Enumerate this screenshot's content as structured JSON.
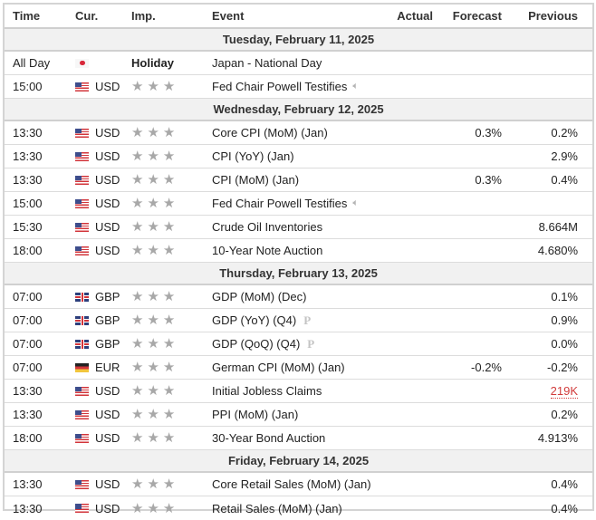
{
  "header": {
    "time": "Time",
    "currency": "Cur.",
    "importance": "Imp.",
    "event": "Event",
    "actual": "Actual",
    "forecast": "Forecast",
    "previous": "Previous"
  },
  "days": [
    {
      "label": "Tuesday, February 11, 2025",
      "rows": [
        {
          "time": "All Day",
          "flag": "jp",
          "currency": "",
          "importance": "Holiday",
          "event": "Japan - National Day",
          "icon": "",
          "actual": "",
          "forecast": "",
          "previous": ""
        },
        {
          "time": "15:00",
          "flag": "us",
          "currency": "USD",
          "importance": 3,
          "event": "Fed Chair Powell Testifies",
          "icon": "sound",
          "actual": "",
          "forecast": "",
          "previous": ""
        }
      ]
    },
    {
      "label": "Wednesday, February 12, 2025",
      "rows": [
        {
          "time": "13:30",
          "flag": "us",
          "currency": "USD",
          "importance": 3,
          "event": "Core CPI (MoM) (Jan)",
          "icon": "",
          "actual": "",
          "forecast": "0.3%",
          "previous": "0.2%"
        },
        {
          "time": "13:30",
          "flag": "us",
          "currency": "USD",
          "importance": 3,
          "event": "CPI (YoY) (Jan)",
          "icon": "",
          "actual": "",
          "forecast": "",
          "previous": "2.9%"
        },
        {
          "time": "13:30",
          "flag": "us",
          "currency": "USD",
          "importance": 3,
          "event": "CPI (MoM) (Jan)",
          "icon": "",
          "actual": "",
          "forecast": "0.3%",
          "previous": "0.4%"
        },
        {
          "time": "15:00",
          "flag": "us",
          "currency": "USD",
          "importance": 3,
          "event": "Fed Chair Powell Testifies",
          "icon": "sound",
          "actual": "",
          "forecast": "",
          "previous": ""
        },
        {
          "time": "15:30",
          "flag": "us",
          "currency": "USD",
          "importance": 3,
          "event": "Crude Oil Inventories",
          "icon": "",
          "actual": "",
          "forecast": "",
          "previous": "8.664M"
        },
        {
          "time": "18:00",
          "flag": "us",
          "currency": "USD",
          "importance": 3,
          "event": "10-Year Note Auction",
          "icon": "",
          "actual": "",
          "forecast": "",
          "previous": "4.680%"
        }
      ]
    },
    {
      "label": "Thursday, February 13, 2025",
      "rows": [
        {
          "time": "07:00",
          "flag": "gb",
          "currency": "GBP",
          "importance": 3,
          "event": "GDP (MoM) (Dec)",
          "icon": "",
          "actual": "",
          "forecast": "",
          "previous": "0.1%"
        },
        {
          "time": "07:00",
          "flag": "gb",
          "currency": "GBP",
          "importance": 3,
          "event": "GDP (YoY) (Q4)",
          "icon": "preliminary",
          "actual": "",
          "forecast": "",
          "previous": "0.9%"
        },
        {
          "time": "07:00",
          "flag": "gb",
          "currency": "GBP",
          "importance": 3,
          "event": "GDP (QoQ) (Q4)",
          "icon": "preliminary",
          "actual": "",
          "forecast": "",
          "previous": "0.0%"
        },
        {
          "time": "07:00",
          "flag": "de",
          "currency": "EUR",
          "importance": 3,
          "event": "German CPI (MoM) (Jan)",
          "icon": "",
          "actual": "",
          "forecast": "-0.2%",
          "previous": "-0.2%"
        },
        {
          "time": "13:30",
          "flag": "us",
          "currency": "USD",
          "importance": 3,
          "event": "Initial Jobless Claims",
          "icon": "",
          "actual": "",
          "forecast": "",
          "previous": "219K",
          "previous_revised": true
        },
        {
          "time": "13:30",
          "flag": "us",
          "currency": "USD",
          "importance": 3,
          "event": "PPI (MoM) (Jan)",
          "icon": "",
          "actual": "",
          "forecast": "",
          "previous": "0.2%"
        },
        {
          "time": "18:00",
          "flag": "us",
          "currency": "USD",
          "importance": 3,
          "event": "30-Year Bond Auction",
          "icon": "",
          "actual": "",
          "forecast": "",
          "previous": "4.913%"
        }
      ]
    },
    {
      "label": "Friday, February 14, 2025",
      "rows": [
        {
          "time": "13:30",
          "flag": "us",
          "currency": "USD",
          "importance": 3,
          "event": "Core Retail Sales (MoM) (Jan)",
          "icon": "",
          "actual": "",
          "forecast": "",
          "previous": "0.4%"
        },
        {
          "time": "13:30",
          "flag": "us",
          "currency": "USD",
          "importance": 3,
          "event": "Retail Sales (MoM) (Jan)",
          "icon": "",
          "actual": "",
          "forecast": "",
          "previous": "0.4%"
        }
      ]
    }
  ],
  "colors": {
    "revised_previous": "#d13b3b",
    "star": "#a8a8a8",
    "day_row_bg": "#f1f1f1"
  },
  "icons": {
    "star": "★",
    "sound": "🔈︎",
    "preliminary": "P"
  }
}
